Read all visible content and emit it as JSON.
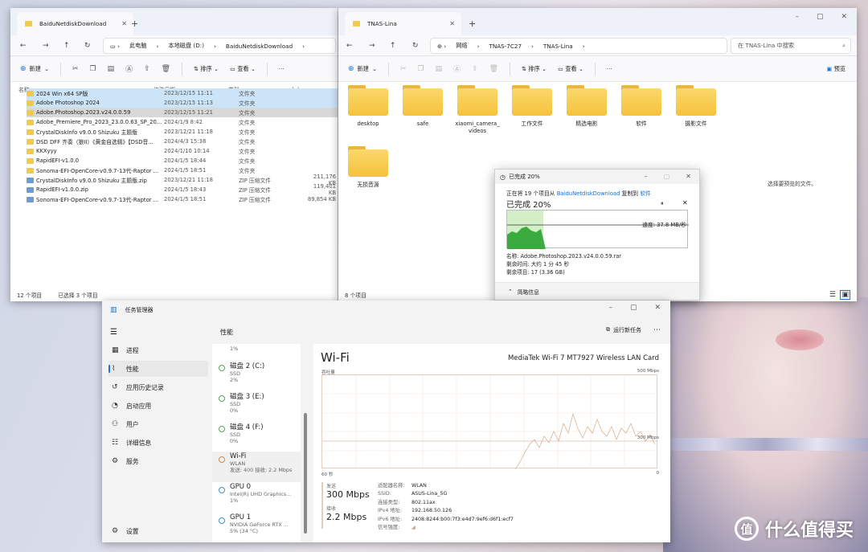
{
  "explorer_left": {
    "tab_title": "BaiduNetdiskDownload",
    "breadcrumb": [
      "此电脑",
      "本地磁盘 (D:)",
      "BaiduNetdiskDownload"
    ],
    "toolbar": {
      "new": "新建",
      "sort": "排序",
      "view": "查看",
      "more": "···"
    },
    "columns": {
      "name": "名称",
      "date": "修改日期",
      "type": "类型",
      "size": "大小"
    },
    "files": [
      {
        "name": "2024 Win x64 SP版",
        "date": "2023/12/15 11:11",
        "type": "文件夹",
        "size": "",
        "kind": "folder",
        "sel": "sel"
      },
      {
        "name": "Adobe Photoshop 2024",
        "date": "2023/12/15 11:13",
        "type": "文件夹",
        "size": "",
        "kind": "folder",
        "sel": "sel"
      },
      {
        "name": "Adobe.Photoshop.2023.v24.0.0.59",
        "date": "2023/12/15 11:21",
        "type": "文件夹",
        "size": "",
        "kind": "folder",
        "sel": "sel2"
      },
      {
        "name": "Adobe_Premiere_Pro_2023_23.0.0.63_SP_20...",
        "date": "2024/1/9 8:42",
        "type": "文件夹",
        "size": "",
        "kind": "folder",
        "sel": ""
      },
      {
        "name": "CrystalDiskInfo v9.0.0 Shizuku 主题版",
        "date": "2023/12/21 11:18",
        "type": "文件夹",
        "size": "",
        "kind": "folder",
        "sel": ""
      },
      {
        "name": "DSD DFF 齐奏（狼II）《黄金自选辑》【DSD音...",
        "date": "2024/4/3 15:38",
        "type": "文件夹",
        "size": "",
        "kind": "folder",
        "sel": ""
      },
      {
        "name": "KKXyyy",
        "date": "2024/1/10 10:14",
        "type": "文件夹",
        "size": "",
        "kind": "folder",
        "sel": ""
      },
      {
        "name": "RapidEFI-v1.0.0",
        "date": "2024/1/5 18:44",
        "type": "文件夹",
        "size": "",
        "kind": "folder",
        "sel": ""
      },
      {
        "name": "Sonoma-EFI-OpenCore-v0.9.7-13代-Raptor ...",
        "date": "2024/1/5 18:51",
        "type": "文件夹",
        "size": "",
        "kind": "folder",
        "sel": ""
      },
      {
        "name": "CrystalDiskInfo v9.0.0 Shizuku 主题版.zip",
        "date": "2023/12/21 11:18",
        "type": "ZIP 压缩文件",
        "size": "211,176 KB",
        "kind": "zip",
        "sel": ""
      },
      {
        "name": "RapidEFI-v1.0.0.zip",
        "date": "2024/1/5 18:43",
        "type": "ZIP 压缩文件",
        "size": "119,401 KB",
        "kind": "zip",
        "sel": ""
      },
      {
        "name": "Sonoma-EFI-OpenCore-v0.9.7-13代-Raptor ...",
        "date": "2024/1/5 18:51",
        "type": "ZIP 压缩文件",
        "size": "89,854 KB",
        "kind": "zip",
        "sel": ""
      }
    ],
    "status": {
      "count": "12 个项目",
      "selected": "已选择 3 个项目"
    }
  },
  "explorer_right": {
    "tab_title": "TNAS-Lina",
    "breadcrumb": [
      "网络",
      "TNAS-7C27",
      "TNAS-Lina"
    ],
    "search_placeholder": "在 TNAS-Lina 中搜索",
    "toolbar": {
      "new": "新建",
      "sort": "排序",
      "view": "查看",
      "more": "···",
      "preview": "预览"
    },
    "folders": [
      "desktop",
      "safe",
      "xiaomi_camera_\nvideos",
      "工作文件",
      "精选电影",
      "软件",
      "摄影文件",
      "无损音源"
    ],
    "preview_hint": "选择要预览的文件。",
    "status": {
      "count": "8 个项目"
    }
  },
  "copy_dialog": {
    "title": "已完成 20%",
    "line_prefix": "正在将 19 个项目从",
    "source": "BaiduNetdiskDownload",
    "line_mid": "复制到",
    "dest": "软件",
    "big": "已完成 20%",
    "pause": "⏸",
    "close": "✕",
    "speed": "速度: 37.8 MB/秒",
    "progress": 0.2,
    "name": "名称: Adobe.Photoshop.2023.v24.0.0.59.rar",
    "remaining_time": "剩余时间: 大约 1 分 45 秒",
    "remaining_items": "剩余项目: 17 (3.36 GB)",
    "less": "简略信息"
  },
  "task_manager": {
    "title": "任务管理器",
    "nav": [
      "进程",
      "性能",
      "应用历史记录",
      "启动应用",
      "用户",
      "详细信息",
      "服务"
    ],
    "settings": "设置",
    "section": "性能",
    "run_task": "运行新任务",
    "devices": [
      {
        "name": "",
        "sub": "1%",
        "sub2": ""
      },
      {
        "name": "磁盘 2 (C:)",
        "sub": "SSD",
        "sub2": "2%"
      },
      {
        "name": "磁盘 3 (E:)",
        "sub": "SSD",
        "sub2": "0%"
      },
      {
        "name": "磁盘 4 (F:)",
        "sub": "SSD",
        "sub2": "0%"
      },
      {
        "name": "Wi-Fi",
        "sub": "WLAN",
        "sub2": "发送: 400 接收: 2.2 Mbps"
      },
      {
        "name": "GPU 0",
        "sub": "Intel(R) UHD Graphics...",
        "sub2": "1%"
      },
      {
        "name": "GPU 1",
        "sub": "NVIDIA GeForce RTX ...",
        "sub2": "5% (34 °C)"
      }
    ],
    "wifi": {
      "title": "Wi-Fi",
      "adapter": "MediaTek Wi-Fi 7 MT7927 Wireless LAN Card",
      "throughput_label": "吞吐量",
      "max": "500 Mbps",
      "mid": "300 Mbps",
      "time": "60 秒",
      "zero": "0",
      "send_label": "发送",
      "send_value": "300 Mbps",
      "recv_label": "接收",
      "recv_value": "2.2 Mbps",
      "props": [
        {
          "k": "适配器名称:",
          "v": "WLAN"
        },
        {
          "k": "SSID:",
          "v": "ASUS-Lina_5G"
        },
        {
          "k": "连接类型:",
          "v": "802.11ax"
        },
        {
          "k": "IPv4 地址:",
          "v": "192.168.50.126"
        },
        {
          "k": "IPv6 地址:",
          "v": "2408:8244:b00:7f3:e4d7:9ef6:d6f1:ecf7"
        },
        {
          "k": "信号强度:",
          "v": ""
        }
      ]
    }
  },
  "watermark": "什么值得买"
}
